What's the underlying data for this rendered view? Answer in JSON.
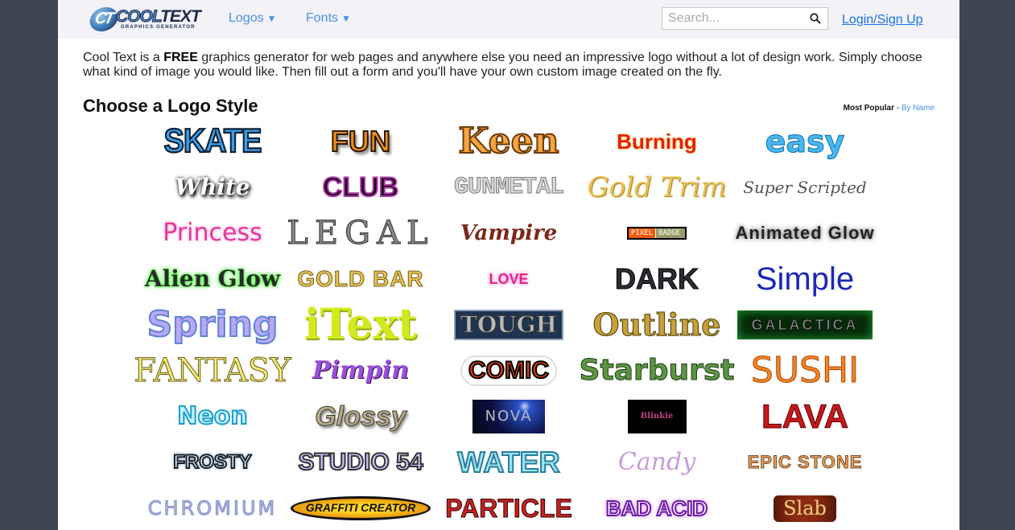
{
  "header": {
    "brand": {
      "word_cool": "COOL",
      "word_text": "TEXT",
      "subtitle": "GRAPHICS GENERATOR",
      "mark": "CT"
    },
    "nav": [
      {
        "label": "Logos",
        "caret": "▼"
      },
      {
        "label": "Fonts",
        "caret": "▼"
      }
    ],
    "search": {
      "placeholder": "Search...",
      "value": "",
      "icon": "search-icon"
    },
    "login_label": "Login/Sign Up"
  },
  "intro": {
    "before_bold": "Cool Text is a ",
    "bold": "FREE",
    "after_bold": " graphics generator for web pages and anywhere else you need an impressive logo without a lot of design work.  Simply choose what kind of image you would like. Then fill out a form and you'll have your own custom image created on the fly."
  },
  "section": {
    "title": "Choose a Logo Style",
    "sort_active": "Most Popular",
    "sort_separator": " - ",
    "sort_alt": "By Name"
  },
  "logo_styles": [
    {
      "name": "Skate",
      "text": "SKATE"
    },
    {
      "name": "Fun",
      "text": "FUN"
    },
    {
      "name": "Keen",
      "text": "Keen"
    },
    {
      "name": "Burning",
      "text": "Burning"
    },
    {
      "name": "Easy",
      "text": "easy"
    },
    {
      "name": "White",
      "text": "White"
    },
    {
      "name": "Club",
      "text": "CLUB"
    },
    {
      "name": "Gunmetal",
      "text": "GUNMETAL"
    },
    {
      "name": "Gold Trim",
      "text": "Gold Trim"
    },
    {
      "name": "Super Scripted",
      "text": "Super Scripted"
    },
    {
      "name": "Princess",
      "text": "Princess"
    },
    {
      "name": "Legal",
      "text": "LEGAL"
    },
    {
      "name": "Vampire",
      "text": "Vampire"
    },
    {
      "name": "Pixel Badge",
      "text_left": "PIXEL",
      "text_right": "BADGE"
    },
    {
      "name": "Animated Glow",
      "text": "Animated Glow"
    },
    {
      "name": "Alien Glow",
      "text": "Alien Glow"
    },
    {
      "name": "Gold Bar",
      "text": "GOLD BAR"
    },
    {
      "name": "Love",
      "text": "LOVE"
    },
    {
      "name": "Dark",
      "text": "DARK"
    },
    {
      "name": "Simple",
      "text": "Simple"
    },
    {
      "name": "Spring",
      "text": "Spring"
    },
    {
      "name": "iText",
      "text": "iText"
    },
    {
      "name": "Tough",
      "text": "TOUGH"
    },
    {
      "name": "Outline",
      "text": "Outline"
    },
    {
      "name": "Galactica",
      "text": "GALACTICA"
    },
    {
      "name": "Fantasy",
      "text": "FANTASY"
    },
    {
      "name": "Pimpin",
      "text": "Pimpin"
    },
    {
      "name": "Comic",
      "text": "COMIC"
    },
    {
      "name": "Starburst",
      "text": "Starburst"
    },
    {
      "name": "Sushi",
      "text": "SUSHI"
    },
    {
      "name": "Neon",
      "text": "Neon"
    },
    {
      "name": "Glossy",
      "text": "Glossy"
    },
    {
      "name": "Nova",
      "text": "NOVA"
    },
    {
      "name": "Blinkie",
      "text": "Blinkie"
    },
    {
      "name": "Lava",
      "text": "LAVA"
    },
    {
      "name": "Frosty",
      "text": "FROSTY"
    },
    {
      "name": "Studio 54",
      "text": "STUDIO 54"
    },
    {
      "name": "Water",
      "text": "WATER"
    },
    {
      "name": "Candy",
      "text": "Candy"
    },
    {
      "name": "Epic Stone",
      "text": "EPIC STONE"
    },
    {
      "name": "Chromium",
      "text": "CHROMIUM"
    },
    {
      "name": "Graffiti Creator",
      "text": "GRAFFITI CREATOR"
    },
    {
      "name": "Particle",
      "text": "PARTICLE"
    },
    {
      "name": "Bad Acid",
      "text": "BAD ACID"
    },
    {
      "name": "Slab",
      "text": "Slab"
    }
  ],
  "colors": {
    "outer_background": "#3f4550",
    "header_background": "#f2f2f7",
    "link": "#4a90e2",
    "login_link": "#1a73e8"
  }
}
